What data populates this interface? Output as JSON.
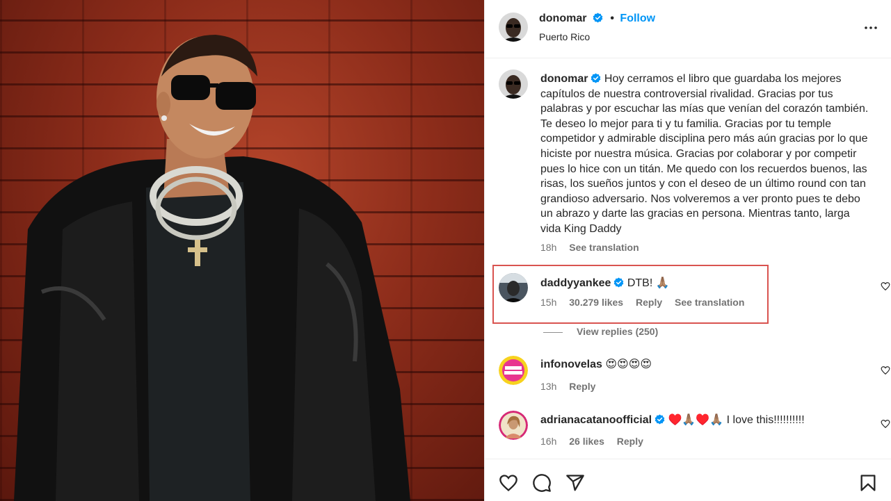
{
  "post": {
    "author": "donomar",
    "follow_label": "Follow",
    "location": "Puerto Rico"
  },
  "caption": {
    "username": "donomar",
    "text": "Hoy cerramos el libro que guardaba los mejores capítulos de nuestra controversial rivalidad. Gracias por tus palabras y por escuchar las mías que venían del corazón también. Te deseo lo mejor para ti y tu familia. Gracias por tu temple competidor y admirable disciplina pero más aún gracias por lo que hiciste por nuestra música. Gracias por colaborar y por competir pues lo hice con un titán. Me quedo con los recuerdos buenos, las risas, los sueños juntos y con el deseo de un último round con tan grandioso adversario. Nos volveremos a ver pronto pues te debo un abrazo y darte las gracias en persona. Mientras tanto, larga vida King Daddy",
    "time": "18h",
    "see_translation": "See translation"
  },
  "comments": [
    {
      "username": "daddyyankee",
      "text": "DTB! 🙏🏽",
      "time": "15h",
      "likes": "30.279 likes",
      "reply": "Reply",
      "see_translation": "See translation",
      "view_replies": "View replies (250)"
    },
    {
      "username": "infonovelas",
      "text": "😍😍😍😍",
      "time": "13h",
      "reply": "Reply"
    },
    {
      "username": "adrianacatanoofficial",
      "text": "♥️🙏🏽♥️🙏🏽 I love this!!!!!!!!!!",
      "time": "16h",
      "likes": "26 likes",
      "reply": "Reply"
    }
  ],
  "icons": {
    "verified": "verified-badge-icon",
    "more": "more-options-icon",
    "like": "heart-icon",
    "comment": "comment-icon",
    "share": "share-icon",
    "save": "bookmark-icon"
  },
  "colors": {
    "accent": "#0095f6",
    "highlight_box": "#d9534f",
    "text": "#262626",
    "secondary": "#737373"
  }
}
